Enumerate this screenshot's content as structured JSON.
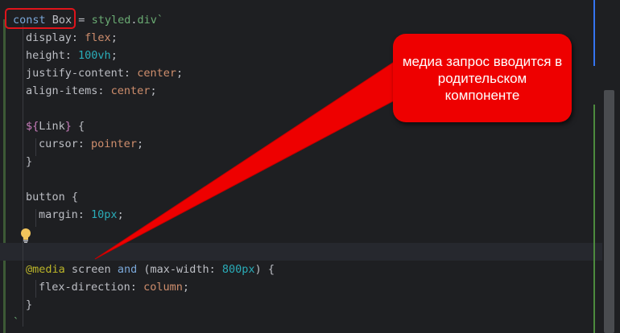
{
  "code": {
    "line1": {
      "kw": "const",
      "id": "Box",
      "op": " = ",
      "obj": "styled",
      "dot": ".",
      "tag": "div",
      "tick": "`"
    },
    "line2": {
      "prop": "display",
      "colon": ": ",
      "val": "flex",
      "semi": ";"
    },
    "line3": {
      "prop": "height",
      "colon": ": ",
      "num": "100vh",
      "semi": ";"
    },
    "line4": {
      "prop": "justify-content",
      "colon": ": ",
      "val": "center",
      "semi": ";"
    },
    "line5": {
      "prop": "align-items",
      "colon": ": ",
      "val": "center",
      "semi": ";"
    },
    "line7": {
      "open": "${",
      "name": "Link",
      "close": "}",
      "brace": " {"
    },
    "line8": {
      "prop": "cursor",
      "colon": ": ",
      "val": "pointer",
      "semi": ";"
    },
    "line9": {
      "brace": "}"
    },
    "line11": {
      "sel": "button",
      "brace": " {"
    },
    "line12": {
      "prop": "margin",
      "colon": ": ",
      "num": "10px",
      "semi": ";"
    },
    "line15": {
      "at": "@media",
      "space1": " ",
      "screen": "screen",
      "space2": " ",
      "and": "and",
      "paren_open": " (",
      "prop": "max-width",
      "colon": ": ",
      "num": "800px",
      "paren_close": ")",
      "brace": " {"
    },
    "line16": {
      "prop": "flex-direction",
      "colon": ": ",
      "val": "column",
      "semi": ";"
    },
    "line17": {
      "brace": "}"
    },
    "line18": {
      "tick": "`"
    }
  },
  "callout": {
    "text": "медиа запрос вводится в родительском компоненте"
  },
  "colors": {
    "callout_bg": "#ee0000",
    "highlight_border": "#e0141b"
  }
}
